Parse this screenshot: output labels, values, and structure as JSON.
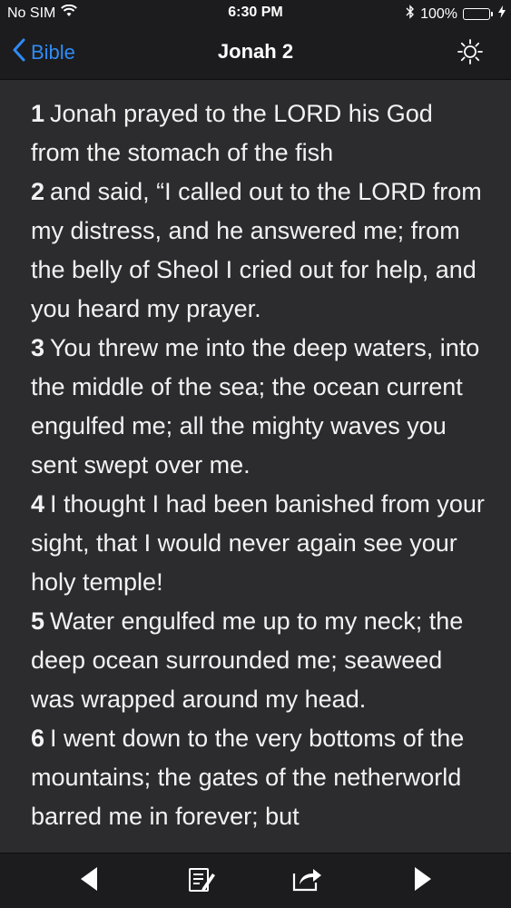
{
  "status_bar": {
    "carrier": "No SIM",
    "time": "6:30 PM",
    "battery": "100%",
    "icons": [
      "wifi-icon",
      "bluetooth-icon",
      "battery-icon",
      "charging-icon"
    ]
  },
  "nav": {
    "back_label": "Bible",
    "title": "Jonah 2",
    "back_icon": "chevron-left-icon",
    "right_icon": "brightness-icon"
  },
  "colors": {
    "accent": "#2f8bf5",
    "background": "#2c2c2e",
    "bar": "#1c1c1e",
    "battery": "#4cd964"
  },
  "verses": [
    {
      "num": "1",
      "text": "Jonah prayed to the LORD his God from the stomach of the fish"
    },
    {
      "num": "2",
      "text": "and said, “I called out to the LORD from my distress, and he answered me; from the belly of Sheol I cried out for help, and you heard my prayer."
    },
    {
      "num": "3",
      "text": "You threw me into the deep waters, into the middle of the sea; the ocean current engulfed me; all the mighty waves you sent swept over me."
    },
    {
      "num": "4",
      "text": "I thought I had been banished from your sight, that I would never again see your holy temple!"
    },
    {
      "num": "5",
      "text": "Water engulfed me up to my neck; the deep ocean surrounded me; seaweed was wrapped around my head."
    },
    {
      "num": "6",
      "text": "I went down to the very bottoms of the mountains; the gates of the netherworld barred me in forever; but"
    }
  ],
  "toolbar": {
    "icons": [
      "previous-chapter-icon",
      "notes-icon",
      "share-icon",
      "next-chapter-icon"
    ]
  }
}
